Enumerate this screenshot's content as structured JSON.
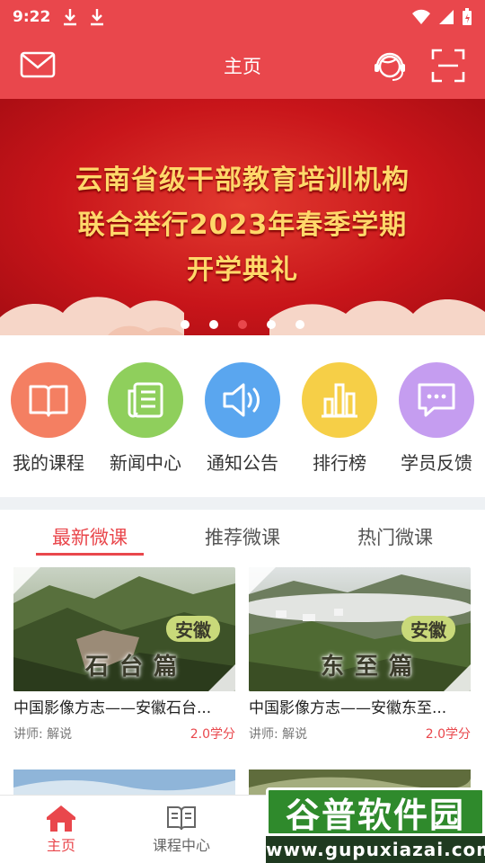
{
  "status": {
    "time": "9:22"
  },
  "header": {
    "title": "主页"
  },
  "banner": {
    "lines": [
      "云南省级干部教育培训机构",
      "联合举行2023年春季学期",
      "开学典礼"
    ],
    "dots": 5,
    "active_dot": 3
  },
  "menu": [
    {
      "label": "我的课程",
      "icon": "book-icon",
      "color": "#f47f62"
    },
    {
      "label": "新闻中心",
      "icon": "news-icon",
      "color": "#8fcf5c"
    },
    {
      "label": "通知公告",
      "icon": "speaker-icon",
      "color": "#5aa6ef"
    },
    {
      "label": "排行榜",
      "icon": "bar-chart-icon",
      "color": "#f6cf47"
    },
    {
      "label": "学员反馈",
      "icon": "chat-icon",
      "color": "#c59df0"
    }
  ],
  "tabs": [
    {
      "label": "最新微课",
      "active": true
    },
    {
      "label": "推荐微课",
      "active": false
    },
    {
      "label": "热门微课",
      "active": false
    }
  ],
  "courses": [
    {
      "title": "中国影像方志——安徽石台...",
      "lecturer": "讲师: 解说",
      "credit": "2.0学分",
      "badge": "安徽",
      "caption": "石台篇"
    },
    {
      "title": "中国影像方志——安徽东至...",
      "lecturer": "讲师: 解说",
      "credit": "2.0学分",
      "badge": "安徽",
      "caption": "东至篇"
    }
  ],
  "bottom_nav": [
    {
      "label": "主页",
      "active": true
    },
    {
      "label": "课程中心",
      "active": false
    }
  ],
  "watermark": {
    "title": "谷普软件园",
    "url": "www.gupuxiazai.com"
  },
  "colors": {
    "primary": "#e9474c",
    "gold_text": "#ffd86a"
  }
}
